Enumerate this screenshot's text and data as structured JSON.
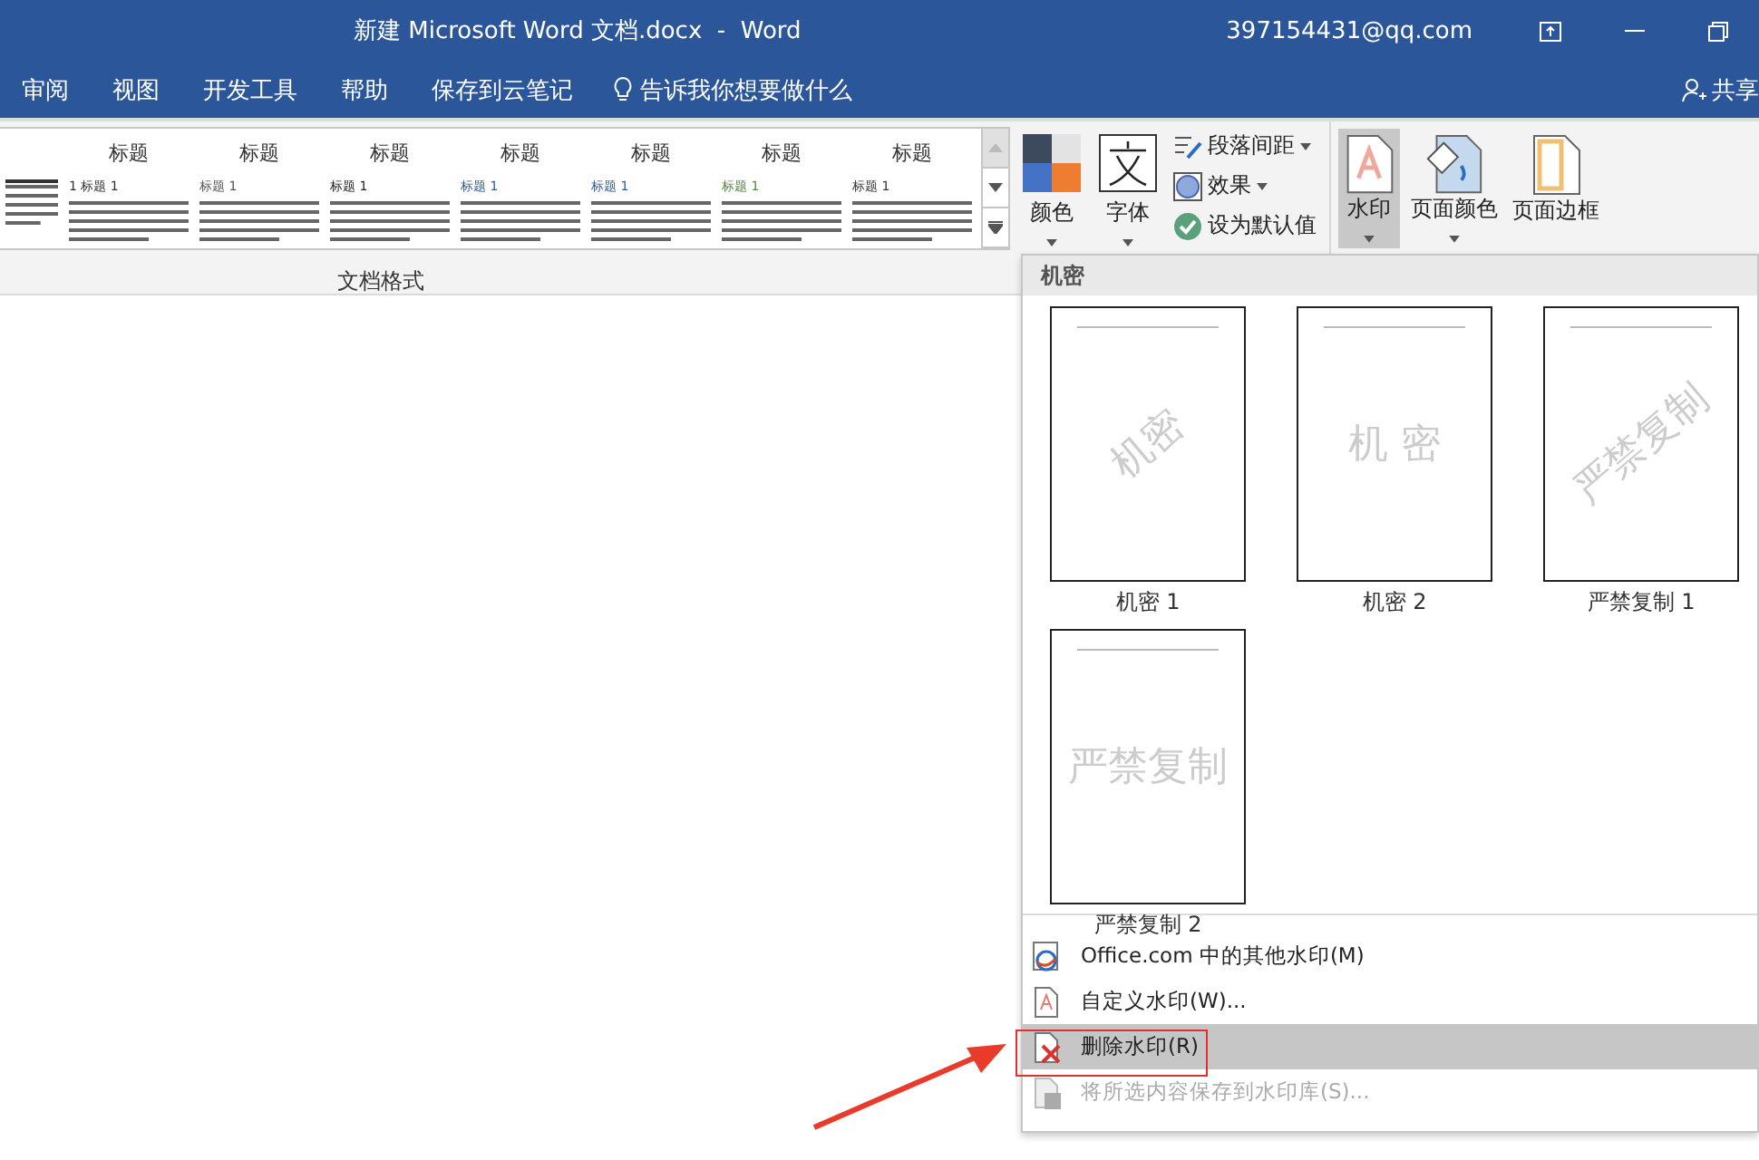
{
  "window": {
    "title": "新建 Microsoft Word 文档.docx  -  Word",
    "account": "397154431@qq.com"
  },
  "tabs": [
    {
      "label": "审阅",
      "selected": false
    },
    {
      "label": "视图",
      "selected": false
    },
    {
      "label": "开发工具",
      "selected": false
    },
    {
      "label": "帮助",
      "selected": false
    },
    {
      "label": "保存到云笔记",
      "selected": false
    }
  ],
  "tell_me": "告诉我你想要做什么",
  "share": "共享",
  "style_gallery": {
    "label": "文档格式",
    "items": [
      {
        "color": "#333333"
      },
      {
        "title": "标题",
        "heading": "1  标题 1",
        "color": "#333333"
      },
      {
        "title": "标题",
        "heading": "标题 1",
        "color": "#555555"
      },
      {
        "title": "标题",
        "heading": "标题 1",
        "color": "#222222"
      },
      {
        "title": "标题",
        "heading": "标题 1",
        "color": "#2e5c9a"
      },
      {
        "title": "标题",
        "heading": "标题 1",
        "color": "#2e5c9a"
      },
      {
        "title": "标题",
        "heading": "标题 1",
        "color": "#4e8a3c"
      },
      {
        "title": "标题",
        "heading": "标题 1",
        "color": "#333333"
      }
    ]
  },
  "design_tools": [
    {
      "kind": "colors",
      "label": "颜色"
    },
    {
      "kind": "fonts",
      "label": "字体"
    }
  ],
  "design_small": [
    {
      "kind": "spacing",
      "label": "段落间距",
      "dropdown": true
    },
    {
      "kind": "effects",
      "label": "效果",
      "dropdown": true
    },
    {
      "kind": "default",
      "label": "设为默认值",
      "dropdown": false
    }
  ],
  "page_background": [
    {
      "kind": "watermark",
      "label": "水印",
      "selected": true,
      "dropdown": true
    },
    {
      "kind": "page_color",
      "label": "页面颜色",
      "selected": false,
      "dropdown": true
    },
    {
      "kind": "page_borders",
      "label": "页面边框",
      "selected": false,
      "dropdown": false
    }
  ],
  "watermark_menu": {
    "section": "机密",
    "watermarks": [
      {
        "text": "机密",
        "label": "机密 1",
        "kind": "diagonal"
      },
      {
        "text": "机 密",
        "label": "机密 2",
        "kind": "horizontal"
      },
      {
        "text": "严禁复制",
        "label": "严禁复制 1",
        "kind": "diagonal"
      },
      {
        "text": "严禁复制",
        "label": "严禁复制 2",
        "kind": "horizontal"
      }
    ],
    "items": [
      {
        "kind": "online",
        "label": "Office.com 中的其他水印(M)",
        "selected": false,
        "disabled": false
      },
      {
        "kind": "custom",
        "label": "自定义水印(W)...",
        "selected": false,
        "disabled": false
      },
      {
        "kind": "remove",
        "label": "删除水印(R)",
        "selected": true,
        "disabled": false
      },
      {
        "kind": "save",
        "label": "将所选内容保存到水印库(S)...",
        "selected": false,
        "disabled": true
      }
    ]
  }
}
